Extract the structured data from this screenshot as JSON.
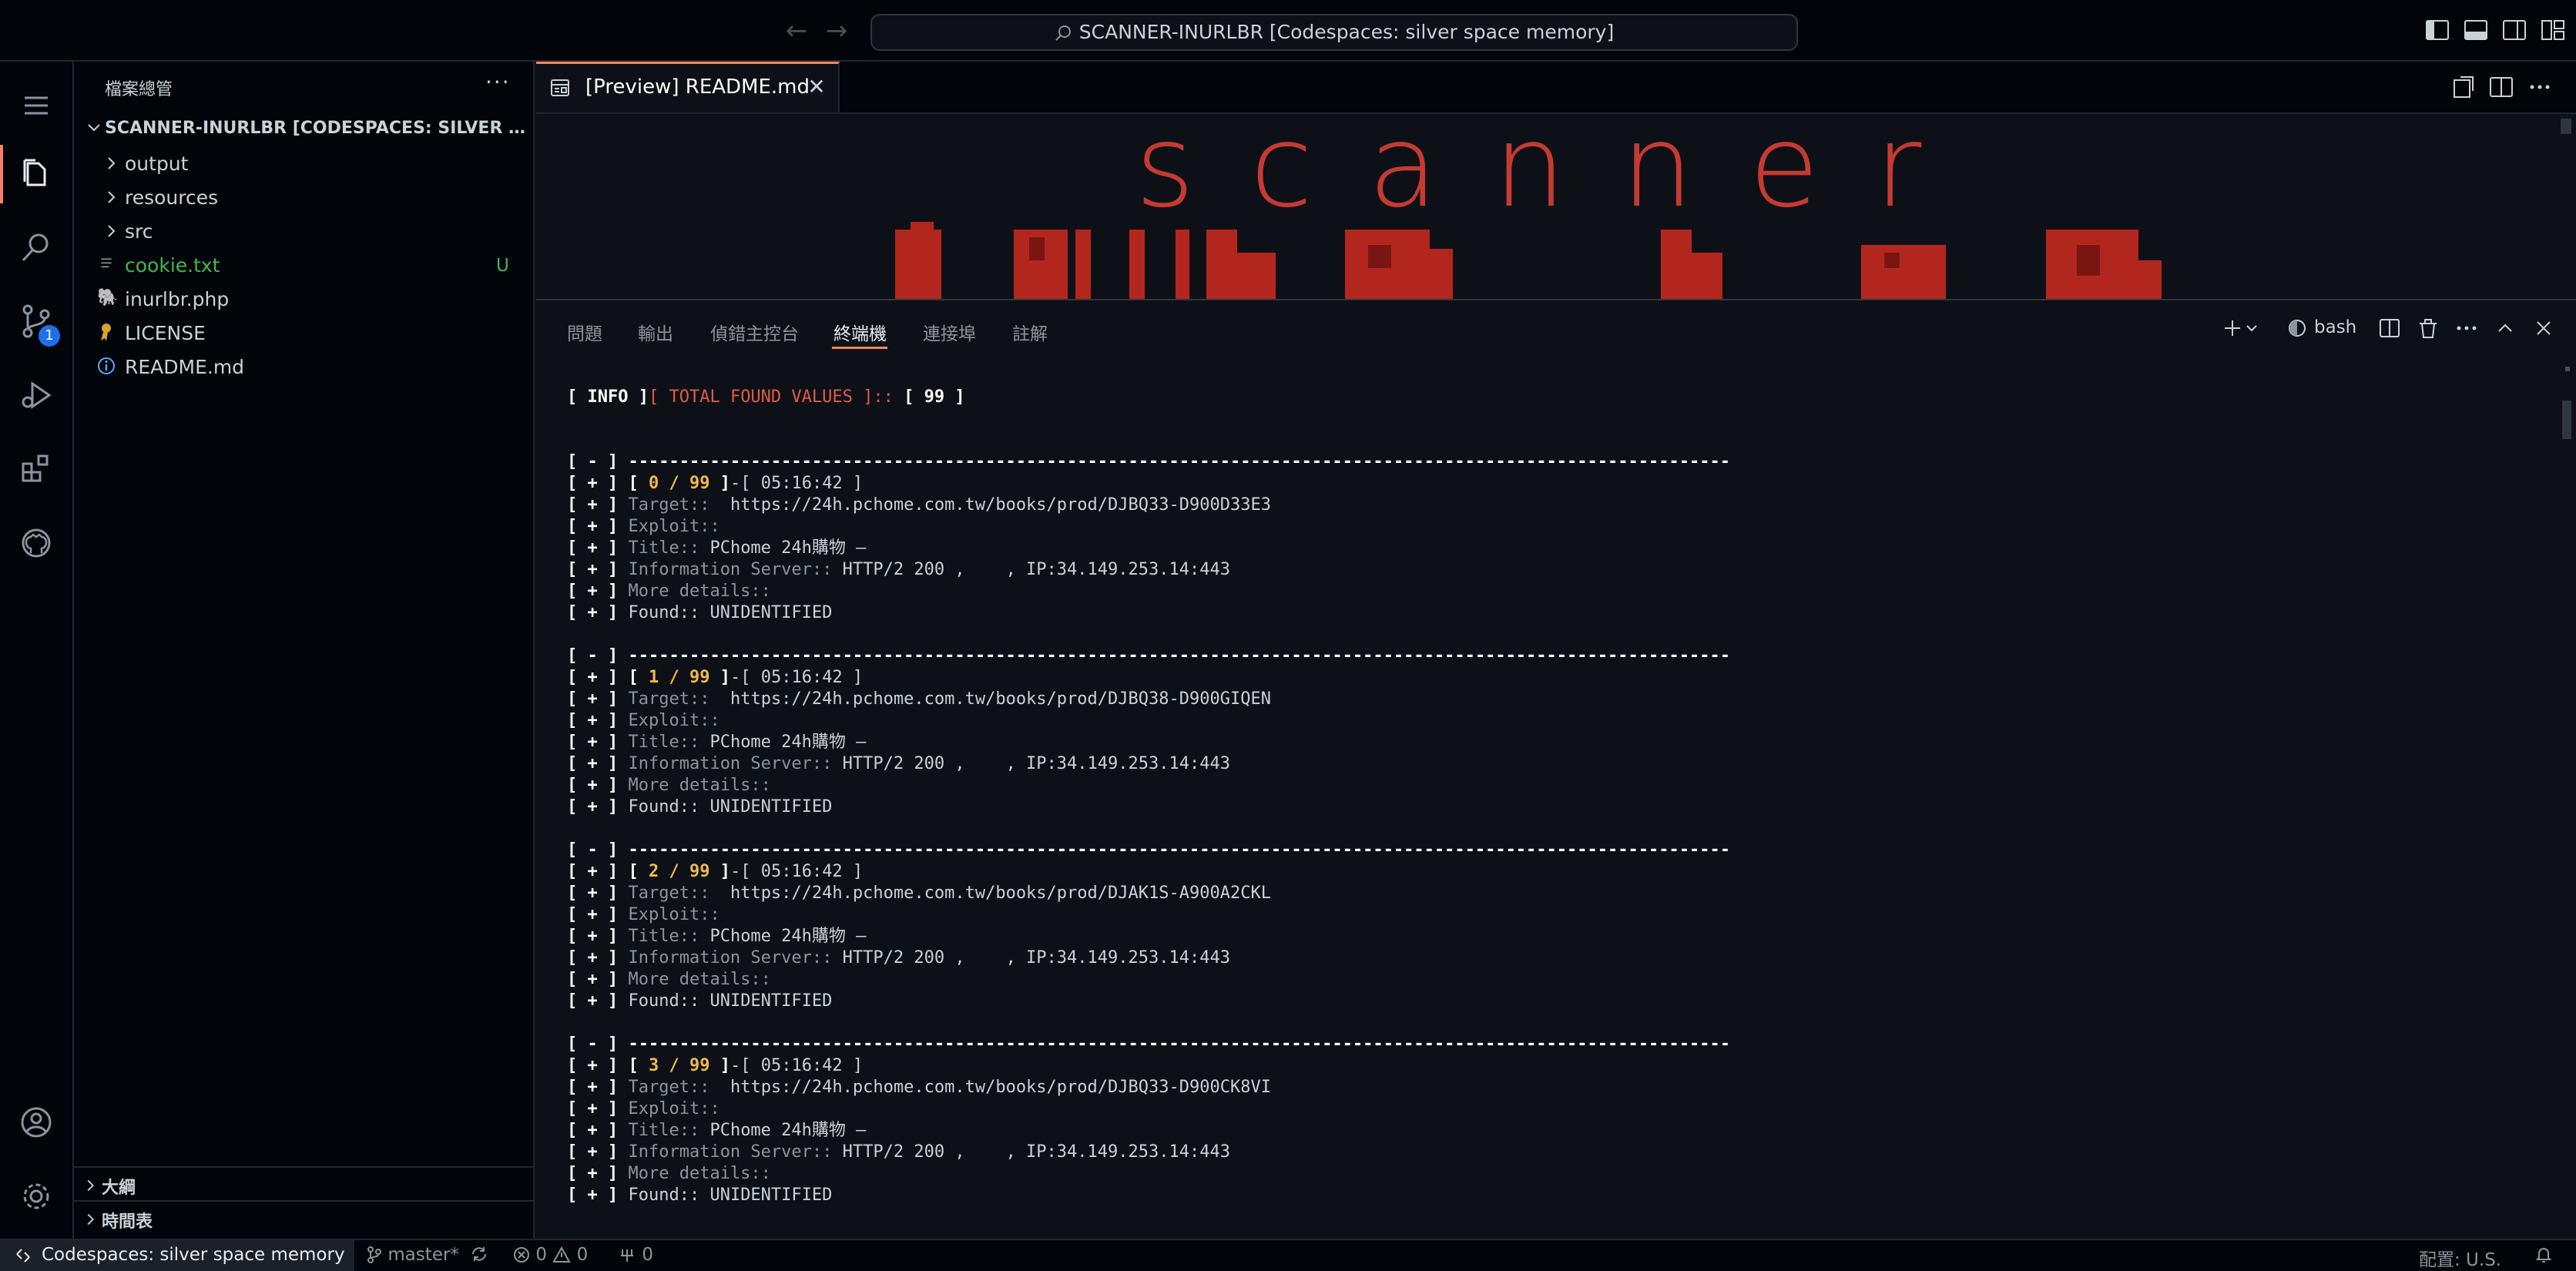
{
  "titlebar": {
    "search_text": "SCANNER-INURLBR [Codespaces: silver space memory]"
  },
  "sidebar": {
    "title": "檔案總管",
    "more": "···",
    "workspace": "SCANNER-INURLBR [CODESPACES: SILVER SPA...",
    "items": [
      {
        "label": "output",
        "type": "folder"
      },
      {
        "label": "resources",
        "type": "folder"
      },
      {
        "label": "src",
        "type": "folder"
      },
      {
        "label": "cookie.txt",
        "type": "file",
        "badge": "U",
        "color": "#3fb950"
      },
      {
        "label": "inurlbr.php",
        "type": "file",
        "icon": "php-elephant-icon"
      },
      {
        "label": "LICENSE",
        "type": "file",
        "icon": "license-icon"
      },
      {
        "label": "README.md",
        "type": "file",
        "icon": "info-icon"
      }
    ],
    "outline": "大綱",
    "timeline": "時間表"
  },
  "activity": {
    "scm_badge": "1"
  },
  "editor": {
    "tab_label": "[Preview] README.md",
    "tab_close": "✕",
    "preview_heading": "scanner"
  },
  "panel": {
    "tabs": [
      "問題",
      "輸出",
      "偵錯主控台",
      "終端機",
      "連接埠",
      "註解"
    ],
    "active_tab": "終端機",
    "shell": "bash",
    "more": "···"
  },
  "terminal": {
    "info_label": "INFO",
    "info_text": "[ TOTAL FOUND VALUES ]::",
    "info_count": "99",
    "separator": "------------------------------------------------------------------------------------------------------------",
    "time": "05:16:42",
    "total": "99",
    "title_value": "PChome 24h購物 –",
    "server_value": "HTTP/2 200 ,    , IP:34.149.253.14:443",
    "found_value": "UNIDENTIFIED",
    "labels": {
      "target": "Target::",
      "exploit": "Exploit::",
      "title": "Title::",
      "server": "Information Server::",
      "more": "More details::",
      "found": "Found::"
    },
    "results": [
      {
        "index": "0",
        "url": "https://24h.pchome.com.tw/books/prod/DJBQ33-D900D33E3"
      },
      {
        "index": "1",
        "url": "https://24h.pchome.com.tw/books/prod/DJBQ38-D900GIQEN"
      },
      {
        "index": "2",
        "url": "https://24h.pchome.com.tw/books/prod/DJAK1S-A900A2CKL"
      },
      {
        "index": "3",
        "url": "https://24h.pchome.com.tw/books/prod/DJBQ33-D900CK8VI"
      }
    ]
  },
  "statusbar": {
    "remote": "Codespaces: silver space memory",
    "branch": "master*",
    "errors": "0",
    "warnings": "0",
    "ports": "0",
    "layout": "配置: U.S."
  },
  "colors": {
    "accent": "#f78166",
    "terminal_yellow": "#f0b84b",
    "terminal_red": "#e05a4a",
    "untracked_green": "#3fb950"
  }
}
